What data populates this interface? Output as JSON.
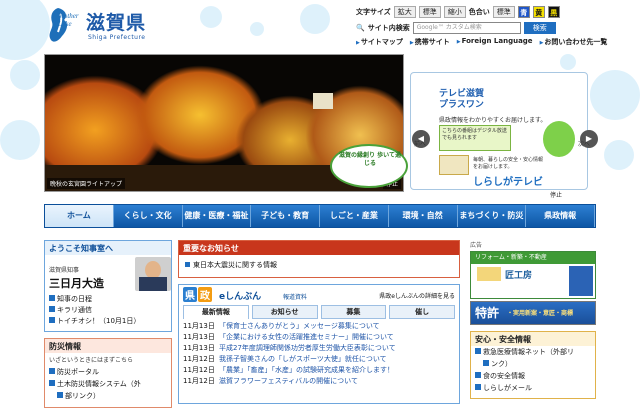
{
  "header": {
    "logo_mother": "Mother",
    "logo_lake": "Lake",
    "title": "滋賀県",
    "subtitle": "Shiga Prefecture"
  },
  "tools": {
    "text_size_label": "文字サイズ",
    "enlarge": "拡大",
    "standard": "標準",
    "shrink": "縮小",
    "color_label": "色合い",
    "color_standard": "標準",
    "color_blue": "青",
    "color_yellow": "黄",
    "color_black": "黒",
    "search_label": "サイト内検索",
    "search_placeholder": "Google™ カスタム検索",
    "search_button": "検索",
    "links": [
      "サイトマップ",
      "携帯サイト",
      "Foreign Language",
      "お問い合わせ先一覧"
    ]
  },
  "hero": {
    "caption": "晩秋の玄宮園ライトアップ",
    "stop": "停止",
    "badge": "滋賀の縁創り 歩いて通じる"
  },
  "banner": {
    "title1": "テレビ滋賀",
    "title2": "プラスワン",
    "desc": "県政情報をわかりやすくお届けします。",
    "green_text": "こちらの番組はデジタル放送でも見られます",
    "note1": "毎朝、暮らしの安全・安心情報",
    "note2": "をお届けします。",
    "tv": "しらしがテレビ",
    "stop": "停止",
    "prev": "前へ",
    "next": "次へ"
  },
  "nav": [
    "ホーム",
    "くらし・文化",
    "健康・医療・福祉",
    "子ども・教育",
    "しごと・産業",
    "環境・自然",
    "まちづくり・防災",
    "県政情報"
  ],
  "welcome": {
    "heading": "ようこそ知事室へ",
    "sub": "滋賀県知事",
    "name": "三日月大造",
    "links": [
      "知事の日程",
      "キラリ通信",
      "トイチオシ！（10月1日）"
    ]
  },
  "bousai": {
    "heading": "防災情報",
    "sub": "いざというときにはまずこちら",
    "links": [
      "防災ポータル",
      "土木防災情報システム（外",
      "部リンク）"
    ]
  },
  "important": {
    "heading": "重要なお知らせ",
    "item": "東日本大震災に関する情報"
  },
  "enews": {
    "badge1": "県",
    "badge2": "政",
    "title": "eしんぶん",
    "tag": "報道資料",
    "detail": "県政eしんぶんの詳細を見る",
    "tabs": [
      "最新情報",
      "お知らせ",
      "募集",
      "催し"
    ],
    "rows": [
      {
        "date": "11月13日",
        "text": "「保育士さんありがとう」メッセージ募集について"
      },
      {
        "date": "11月13日",
        "text": "「企業における女性の活躍推進セミナー」開催について"
      },
      {
        "date": "11月13日",
        "text": "平成27年度調理師関係功労者厚生労働大臣表彰について"
      },
      {
        "date": "11月12日",
        "text": "我孫子智美さんの「しがスポーツ大使」就任について"
      },
      {
        "date": "11月12日",
        "text": "「農業」「畜産」「水産」の試験研究成果を紹介します！"
      },
      {
        "date": "11月12日",
        "text": "滋賀フラワーフェスティバルの開催について"
      }
    ]
  },
  "ads": {
    "label": "広告",
    "ad1_top": "リフォーム・新築・不動産",
    "ad1_text": "匠工房",
    "ad2_text": "特許",
    "ad2_sub": "・実用新案・意匠・商標"
  },
  "anzen": {
    "heading": "安心・安全情報",
    "links": [
      "救急医療情報ネット（外部リ",
      "ンク）",
      "食の安全情報",
      "しらしがメール"
    ]
  }
}
